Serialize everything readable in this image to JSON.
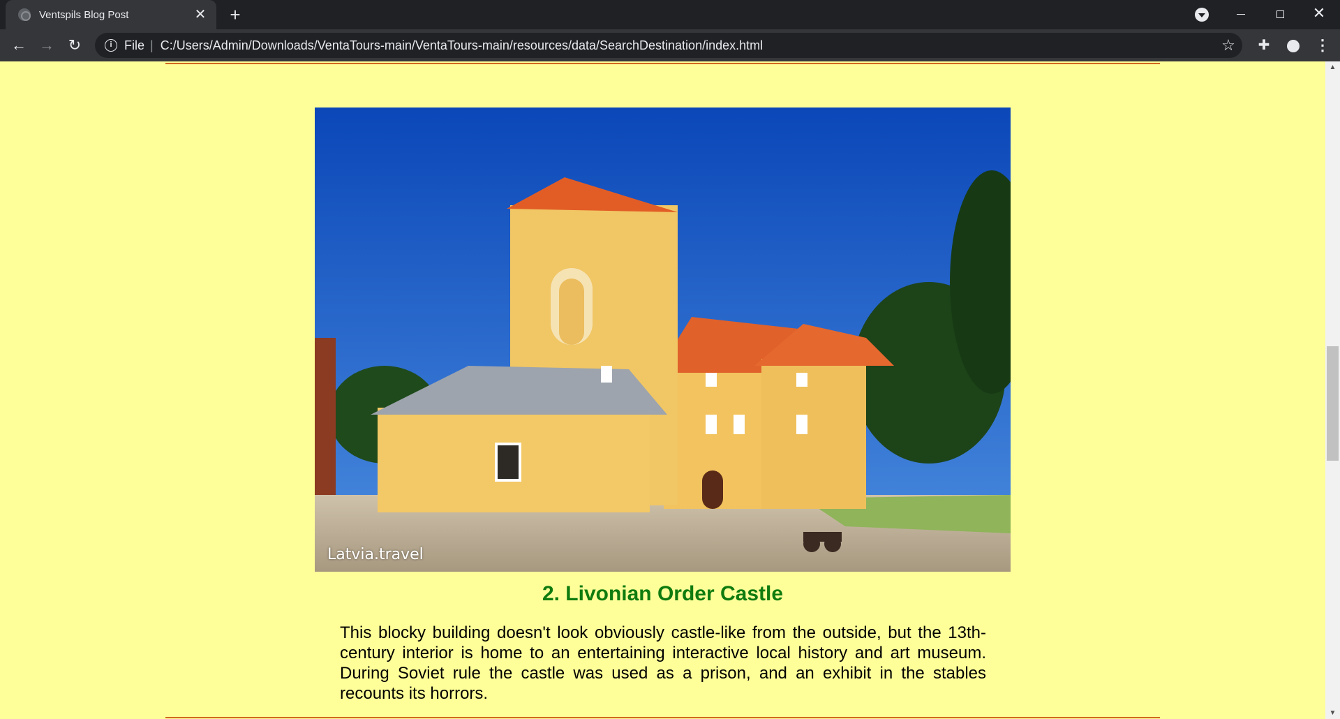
{
  "browser": {
    "tab_title": "Ventspils Blog Post",
    "tab_close": "✕",
    "new_tab": "+",
    "scheme_label": "File",
    "url": "C:/Users/Admin/Downloads/VentaTours-main/VentaTours-main/resources/data/SearchDestination/index.html",
    "icons": {
      "back": "back-arrow-icon",
      "forward": "forward-arrow-icon",
      "reload": "reload-icon",
      "info": "info-icon",
      "bookmark": "star-icon",
      "extensions": "puzzle-icon",
      "account": "account-icon",
      "menu": "kebab-menu-icon"
    }
  },
  "page": {
    "background": "#ffff99",
    "rule_color": "#d2691e",
    "heading_color": "#0f7b0f",
    "image_caption": "Latvia.travel",
    "section_heading": "2. Livonian Order Castle",
    "section_body": "This blocky building doesn't look obviously castle-like from the outside, but the 13th-century interior is home to an entertaining interactive local history and art museum. During Soviet rule the castle was used as a prison, and an exhibit in the stables recounts its horrors."
  }
}
